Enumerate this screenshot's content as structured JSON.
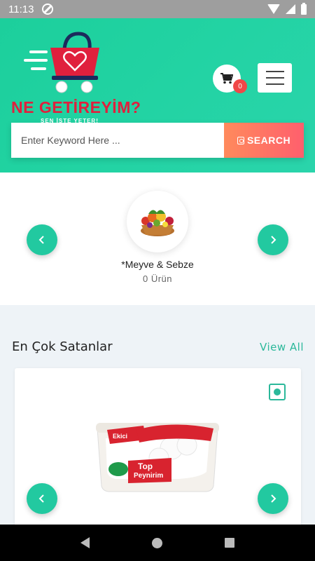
{
  "status_bar": {
    "time": "11:13"
  },
  "header": {
    "logo_title": "NE GETİREYİM?",
    "logo_subtitle": "SEN İSTE YETER!",
    "cart_count": "0",
    "search": {
      "placeholder": "Enter Keyword Here ...",
      "button_label": "SEARCH"
    }
  },
  "categories": {
    "items": [
      {
        "name": "*Meyve & Sebze",
        "count": "0 Ürün",
        "image": "fruit-vegetable-basket"
      }
    ]
  },
  "best_sellers": {
    "title": "En Çok Satanlar",
    "view_all": "View All",
    "product": {
      "brand": "Ekici",
      "name_line1": "Top",
      "name_line2": "Peynirim",
      "image": "cheese-container"
    }
  },
  "colors": {
    "accent": "#22c9a0",
    "brand_red": "#e0203d",
    "search_gradient_start": "#ff8a5c",
    "search_gradient_end": "#ff5f6d"
  }
}
